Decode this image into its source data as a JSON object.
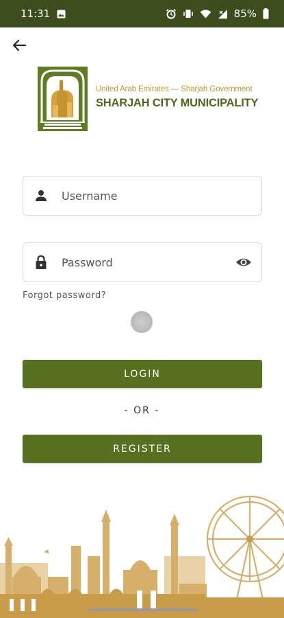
{
  "status_bar": {
    "time": "11:31",
    "battery": "85%",
    "icons": [
      "image-icon",
      "alarm-icon",
      "vibrate-icon",
      "wifi-icon",
      "signal-icon",
      "battery-icon"
    ]
  },
  "nav": {
    "back_icon": "arrow-left-icon"
  },
  "brand": {
    "subtitle": "United Arab Emirates — Sharjah Government",
    "title": "SHARJAH CITY MUNICIPALITY",
    "colors": {
      "primary": "#56701f",
      "gold": "#c7962d"
    }
  },
  "form": {
    "username": {
      "placeholder": "Username",
      "value": "",
      "icon": "person-icon"
    },
    "password": {
      "placeholder": "Password",
      "value": "",
      "icon": "lock-icon",
      "toggle_icon": "eye-icon"
    },
    "forgot_password": "Forgot password?"
  },
  "actions": {
    "login_label": "LOGIN",
    "or_label": "- OR -",
    "register_label": "REGISTER"
  }
}
